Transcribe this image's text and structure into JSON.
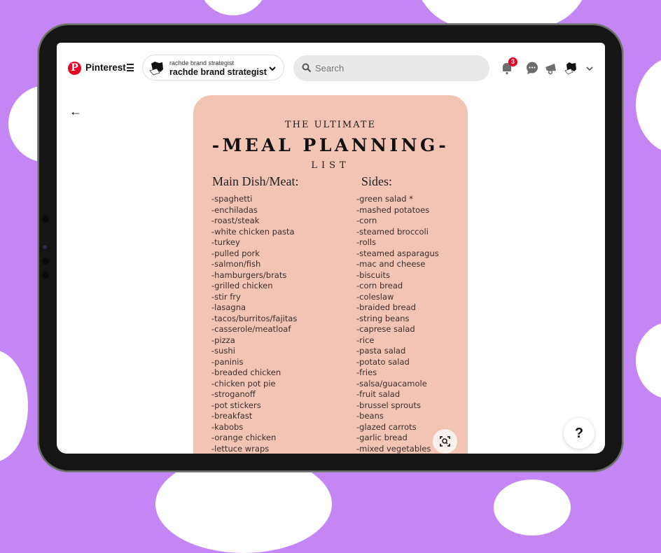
{
  "app": {
    "brand": "Pinterest",
    "account": {
      "small_name": "rachde brand strategist",
      "name": "rachde brand strategist"
    },
    "search": {
      "placeholder": "Search"
    },
    "notifications_count": "3",
    "icons": [
      "pinterest-logo",
      "menu-icon",
      "chevron-down-icon",
      "search-icon",
      "bell-icon",
      "chat-icon",
      "megaphone-icon",
      "avatar",
      "chevron-down-icon",
      "back-arrow-icon",
      "visual-search-icon",
      "help-icon"
    ],
    "back_glyph": "←",
    "help_glyph": "?",
    "colors": {
      "accent": "#e60023",
      "background": "#c486f5",
      "pin_bg": "#f2c4b3"
    }
  },
  "pin": {
    "title_top": "THE ULTIMATE",
    "title_main": "-MEAL PLANNING-",
    "title_bottom": "LIST",
    "main_heading": "Main Dish/Meat:",
    "sides_heading": "Sides:",
    "main_items": [
      "-spaghetti",
      "-enchiladas",
      "-roast/steak",
      "-white chicken pasta",
      "-turkey",
      "-pulled pork",
      "-salmon/fish",
      "-hamburgers/brats",
      "-grilled chicken",
      "-stir fry",
      "-lasagna",
      "-tacos/burritos/fajitas",
      "-casserole/meatloaf",
      "-pizza",
      "-sushi",
      "-paninis",
      "-breaded chicken",
      "-chicken pot pie",
      "-stroganoff",
      "-pot stickers",
      "-breakfast",
      "-kabobs",
      "-orange chicken",
      "-lettuce wraps"
    ],
    "side_items": [
      "-green salad *",
      "-mashed potatoes",
      "-corn",
      "-steamed broccoli",
      "-rolls",
      "-steamed asparagus",
      "-mac and cheese",
      "-biscuits",
      "-corn bread",
      "-coleslaw",
      "-braided bread",
      "-string beans",
      "-caprese salad",
      "-rice",
      "-pasta salad",
      "-potato salad",
      "-fries",
      "-salsa/guacamole",
      "-fruit salad",
      "-brussel sprouts",
      "-beans",
      "-glazed carrots",
      "-garlic bread",
      "-mixed vegetables"
    ]
  }
}
